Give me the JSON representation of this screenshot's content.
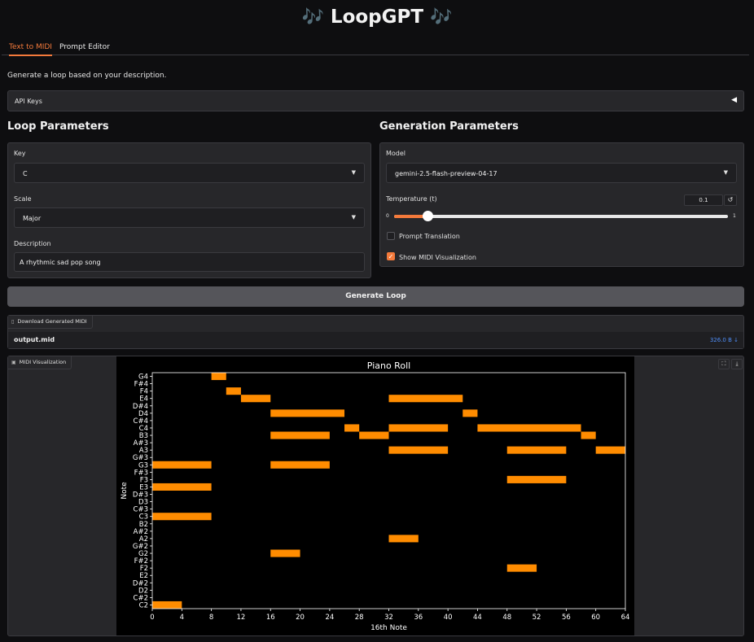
{
  "header": {
    "title": "LoopGPT",
    "title_icon": "🎶"
  },
  "tabs": [
    {
      "label": "Text to MIDI"
    },
    {
      "label": "Prompt Editor"
    }
  ],
  "description": "Generate a loop based on your description.",
  "api_keys": {
    "label": "API Keys",
    "arrow": "◀"
  },
  "loop_params": {
    "heading": "Loop Parameters",
    "key": {
      "label": "Key",
      "value": "C"
    },
    "scale": {
      "label": "Scale",
      "value": "Major"
    },
    "description": {
      "label": "Description",
      "value": "A rhythmic sad pop song"
    }
  },
  "gen_params": {
    "heading": "Generation Parameters",
    "model": {
      "label": "Model",
      "value": "gemini-2.5-flash-preview-04-17"
    },
    "temperature": {
      "label": "Temperature (t)",
      "value": "0.1",
      "fraction": 0.1,
      "min": "0",
      "max": "1",
      "reset": "↺"
    },
    "prompt_translation": {
      "label": "Prompt Translation",
      "checked": false
    },
    "show_midi": {
      "label": "Show MIDI Visualization",
      "checked": true,
      "check": "✓"
    }
  },
  "generate_button": "Generate Loop",
  "download": {
    "label": "Download Generated MIDI",
    "file": "output.mid",
    "size": "326.0 B ↓"
  },
  "viz": {
    "label": "MIDI Visualization",
    "fullscreen": "⛶",
    "download": "⤓"
  },
  "chart_data": {
    "type": "piano-roll",
    "title": "Piano Roll",
    "xlabel": "16th Note",
    "ylabel": "Note",
    "xlim": [
      0,
      64
    ],
    "xticks": [
      0,
      4,
      8,
      12,
      16,
      20,
      24,
      28,
      32,
      36,
      40,
      44,
      48,
      52,
      56,
      60,
      64
    ],
    "notes_axis": [
      "C2",
      "C#2",
      "D2",
      "D#2",
      "E2",
      "F2",
      "F#2",
      "G2",
      "G#2",
      "A2",
      "A#2",
      "B2",
      "C3",
      "C#3",
      "D3",
      "D#3",
      "E3",
      "F3",
      "F#3",
      "G3",
      "G#3",
      "A3",
      "A#3",
      "B3",
      "C4",
      "C#4",
      "D4",
      "D#4",
      "E4",
      "F4",
      "F#4",
      "G4"
    ],
    "color": "#ff8c00",
    "notes": [
      {
        "pitch": "C2",
        "start": 0,
        "end": 4
      },
      {
        "pitch": "C3",
        "start": 0,
        "end": 8
      },
      {
        "pitch": "E3",
        "start": 0,
        "end": 8
      },
      {
        "pitch": "G3",
        "start": 0,
        "end": 8
      },
      {
        "pitch": "G4",
        "start": 8,
        "end": 10
      },
      {
        "pitch": "F4",
        "start": 10,
        "end": 12
      },
      {
        "pitch": "E4",
        "start": 12,
        "end": 16
      },
      {
        "pitch": "D4",
        "start": 16,
        "end": 26
      },
      {
        "pitch": "B3",
        "start": 16,
        "end": 24
      },
      {
        "pitch": "G3",
        "start": 16,
        "end": 24
      },
      {
        "pitch": "G2",
        "start": 16,
        "end": 20
      },
      {
        "pitch": "C4",
        "start": 26,
        "end": 28
      },
      {
        "pitch": "B3",
        "start": 28,
        "end": 32
      },
      {
        "pitch": "E4",
        "start": 32,
        "end": 42
      },
      {
        "pitch": "C4",
        "start": 32,
        "end": 40
      },
      {
        "pitch": "A3",
        "start": 32,
        "end": 40
      },
      {
        "pitch": "A2",
        "start": 32,
        "end": 36
      },
      {
        "pitch": "D4",
        "start": 42,
        "end": 44
      },
      {
        "pitch": "C4",
        "start": 44,
        "end": 58
      },
      {
        "pitch": "A3",
        "start": 48,
        "end": 56
      },
      {
        "pitch": "F3",
        "start": 48,
        "end": 56
      },
      {
        "pitch": "F2",
        "start": 48,
        "end": 52
      },
      {
        "pitch": "B3",
        "start": 58,
        "end": 60
      },
      {
        "pitch": "A3",
        "start": 60,
        "end": 64
      }
    ]
  }
}
